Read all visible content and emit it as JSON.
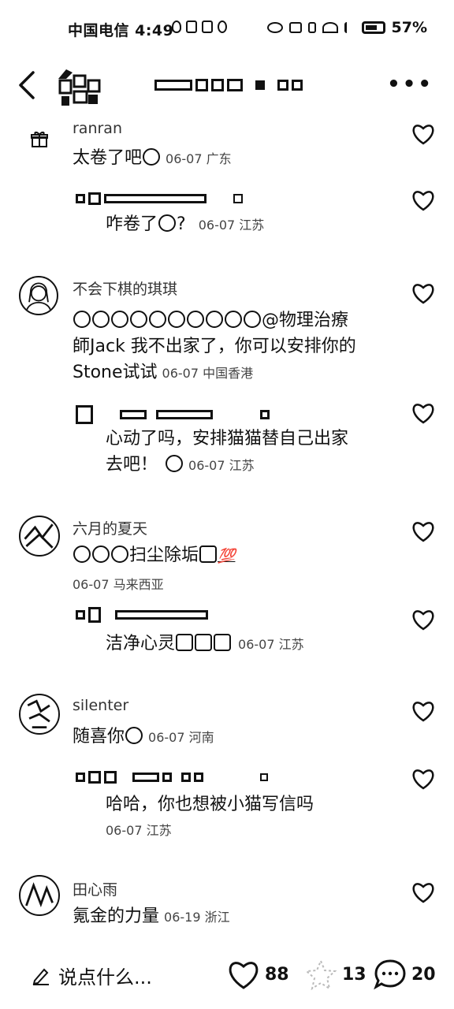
{
  "status_bar": {
    "carrier_time": "中国电信 4:49",
    "battery": "57%"
  },
  "header": {
    "back_icon": "chevron-left-icon",
    "more_icon": "more-dots-icon"
  },
  "comments": [
    {
      "name": "ranran",
      "text": "太卷了吧",
      "date": "06-07 广东",
      "reply": {
        "text": "咋卷了",
        "suffix": "?",
        "date": "06-07 江苏"
      }
    },
    {
      "name": "不会下棋的琪琪",
      "text_line1": "@物理治療",
      "text_line2": "師Jack  我不出家了，你可以安排你的",
      "text_line3": "Stone试试",
      "date": "06-07 中国香港",
      "reply": {
        "text_line1": "心动了吗，安排猫猫替自己出家",
        "text_line2": "去吧！",
        "date": "06-07 江苏"
      }
    },
    {
      "name": "六月的夏天",
      "text": "扫尘除垢",
      "date": "06-07 马来西亚",
      "reply": {
        "text": "洁净心灵",
        "date": "06-07 江苏"
      }
    },
    {
      "name": "silenter",
      "text": "随喜你",
      "date": "06-07 河南",
      "reply": {
        "text": "哈哈，你也想被小猫写信吗",
        "date": "06-07 江苏"
      }
    },
    {
      "name": "田心雨",
      "text": "氪金的力量",
      "date": "06-19 浙江"
    }
  ],
  "bottom_bar": {
    "input_placeholder": "说点什么...",
    "likes": "88",
    "collects": "13",
    "comments": "20"
  }
}
